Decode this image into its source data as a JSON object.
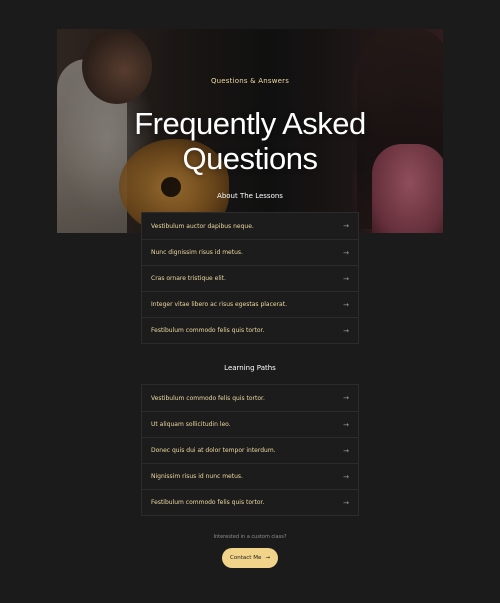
{
  "hero": {
    "eyebrow": "Questions & Answers",
    "title_line1": "Frequently Asked",
    "title_line2": "Questions"
  },
  "sections": [
    {
      "title": "About The Lessons",
      "items": [
        "Vestibulum auctor dapibus neque.",
        "Nunc dignissim risus id metus.",
        "Cras ornare tristique elit.",
        "Integer vitae libero ac risus egestas placerat.",
        "Festibulum commodo felis quis tortor."
      ]
    },
    {
      "title": "Learning Paths",
      "items": [
        "Vestibulum commodo felis quis tortor.",
        "Ut aliquam sollicitudin leo.",
        "Donec quis dui at dolor tempor interdum.",
        "Nignissim risus id nunc metus.",
        "Festibulum commodo felis quis tortor."
      ]
    }
  ],
  "cta": {
    "prompt": "Interested in a custom class?",
    "button_label": "Contact Me",
    "button_icon": "arrow-right-icon"
  },
  "colors": {
    "background": "#1b1b1b",
    "accent": "#f1d48a",
    "question_text": "#efd9a0"
  }
}
